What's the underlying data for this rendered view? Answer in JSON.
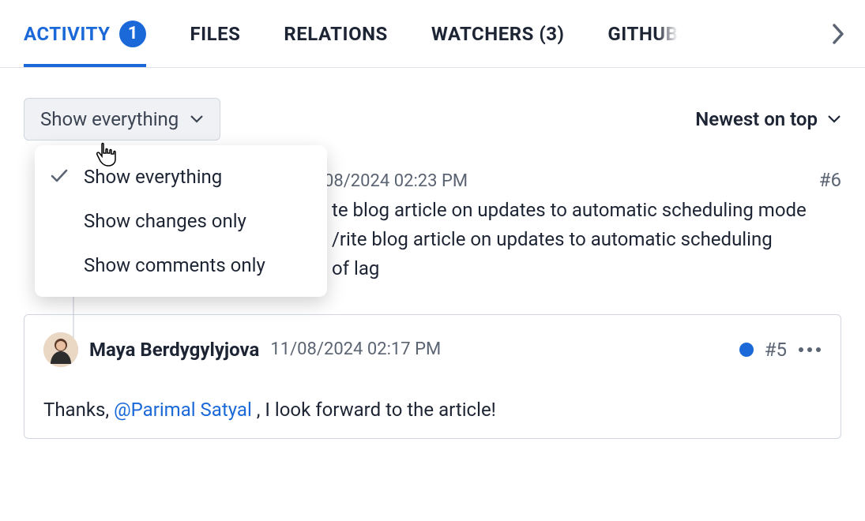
{
  "tabs": {
    "activity": "ACTIVITY",
    "activity_badge": "1",
    "files": "FILES",
    "relations": "RELATIONS",
    "watchers": "WATCHERS (3)",
    "github": "GITHUB"
  },
  "filter": {
    "button_label": "Show everything",
    "options": {
      "everything": "Show everything",
      "changes": "Show changes only",
      "comments": "Show comments only"
    }
  },
  "sort": {
    "label": "Newest on top"
  },
  "entry_change": {
    "timestamp": "08/2024 02:23 PM",
    "number": "#6",
    "line1": "te blog article on updates to automatic scheduling mode",
    "line2": "/rite blog article on updates to automatic scheduling",
    "line3": "of lag"
  },
  "entry_comment": {
    "author": "Maya Berdygylyjova",
    "timestamp": "11/08/2024 02:17 PM",
    "number": "#5",
    "text_before": "Thanks, ",
    "mention": "@Parimal Satyal",
    "text_after": " , I look forward to the article!"
  }
}
